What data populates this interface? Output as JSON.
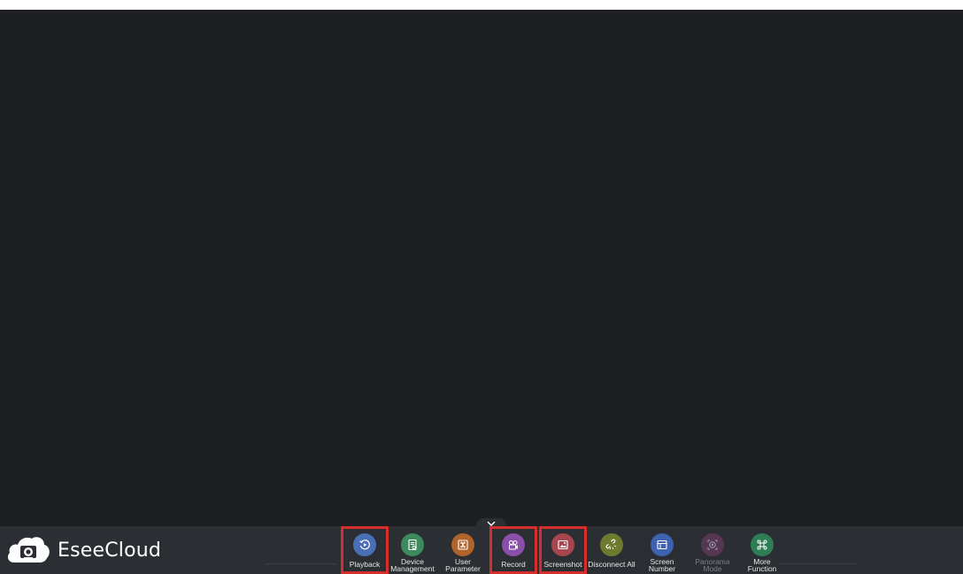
{
  "app": {
    "brand_name": "EseeCloud",
    "logo_icon": "cloud-camera-icon"
  },
  "collapse": {
    "icon": "chevron-down-icon"
  },
  "toolbar": {
    "items": [
      {
        "label": "Playback",
        "icon": "playback-icon",
        "color": "#4a6fb5",
        "highlighted": true
      },
      {
        "label": "Device\nManagement",
        "icon": "device-management-icon",
        "color": "#3d8a5c"
      },
      {
        "label": "User\nParameter",
        "icon": "user-parameter-icon",
        "color": "#b0632a"
      },
      {
        "label": "Record",
        "icon": "record-icon",
        "color": "#8a4fa8",
        "highlighted": true
      },
      {
        "label": "Screenshot",
        "icon": "screenshot-icon",
        "color": "#a8464f",
        "highlighted": true
      },
      {
        "label": "Disconnect All",
        "icon": "disconnect-icon",
        "color": "#6e7a2e"
      },
      {
        "label": "Screen\nNumber",
        "icon": "screen-number-icon",
        "color": "#3e62b0"
      },
      {
        "label": "Panorama\nMode",
        "icon": "panorama-icon",
        "color": "#7a3f72",
        "disabled": true
      },
      {
        "label": "More\nFunction",
        "icon": "more-function-icon",
        "color": "#2f7d55"
      }
    ]
  }
}
